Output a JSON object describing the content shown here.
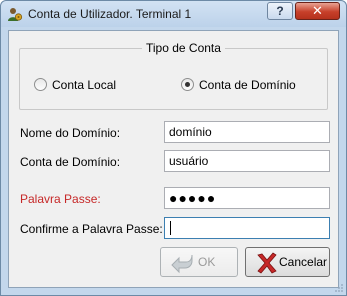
{
  "window": {
    "title": "Conta de Utilizador. Terminal 1",
    "help_label": "?",
    "close_label": "✕"
  },
  "account_type": {
    "title": "Tipo de Conta",
    "options": [
      {
        "label": "Conta Local",
        "selected": false
      },
      {
        "label": "Conta de Domínio",
        "selected": true
      }
    ]
  },
  "form": {
    "domain_name": {
      "label": "Nome do Domínio:",
      "value": "domínio"
    },
    "domain_account": {
      "label": "Conta de Domínio:",
      "value": "usuário"
    },
    "password": {
      "label": "Palavra Passe:",
      "value": "●●●●●",
      "label_color": "#c62828"
    },
    "confirm_password": {
      "label": "Confirme a Palavra Passe:",
      "value": ""
    }
  },
  "buttons": {
    "ok": {
      "label": "OK",
      "enabled": false
    },
    "cancel": {
      "label": "Cancelar",
      "enabled": true
    }
  },
  "colors": {
    "title_bar": "#c3d7ec",
    "close_button": "#c7402a",
    "warning_label": "#c62828",
    "focus_border": "#3c7fb1"
  }
}
